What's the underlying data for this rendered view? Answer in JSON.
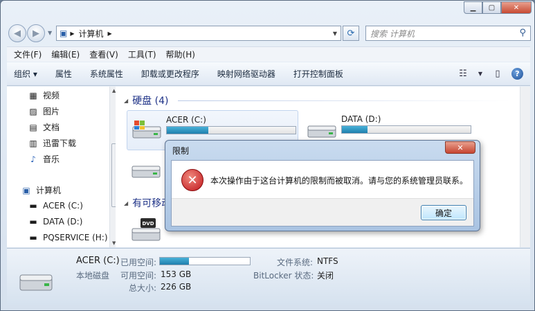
{
  "address": {
    "crumb": "计算机"
  },
  "search": {
    "placeholder": "搜索 计算机"
  },
  "menu": [
    "文件(F)",
    "编辑(E)",
    "查看(V)",
    "工具(T)",
    "帮助(H)"
  ],
  "toolbar": {
    "organize": "组织 ▾",
    "items": [
      "属性",
      "系统属性",
      "卸载或更改程序",
      "映射网络驱动器",
      "打开控制面板"
    ]
  },
  "sidebar": {
    "items": [
      {
        "label": "视频",
        "icon": "video-icon"
      },
      {
        "label": "图片",
        "icon": "picture-icon"
      },
      {
        "label": "文档",
        "icon": "document-icon"
      },
      {
        "label": "迅雷下载",
        "icon": "download-icon"
      },
      {
        "label": "音乐",
        "icon": "music-icon"
      },
      {
        "label": "计算机",
        "icon": "computer-icon"
      },
      {
        "label": "ACER (C:)",
        "icon": "drive-c-icon"
      },
      {
        "label": "DATA (D:)",
        "icon": "drive-icon"
      },
      {
        "label": "PQSERVICE (H:)",
        "icon": "drive-icon"
      }
    ]
  },
  "groups": {
    "hard_disks": "硬盘 (4)",
    "removable": "有可移动"
  },
  "drives": [
    {
      "name": "ACER (C:)",
      "used_fraction": 0.32
    },
    {
      "name": "DATA (D:)",
      "used_fraction": 0.2
    }
  ],
  "dvd": {
    "badge": "DVD"
  },
  "details": {
    "name": "ACER (C:)",
    "type": "本地磁盘",
    "used_label": "已用空间:",
    "used_fraction": 0.32,
    "free_label": "可用空间:",
    "free_value": "153 GB",
    "total_label": "总大小:",
    "total_value": "226 GB",
    "fs_label": "文件系统:",
    "fs_value": "NTFS",
    "bitlocker_label": "BitLocker 状态:",
    "bitlocker_value": "关闭"
  },
  "dialog": {
    "title": "限制",
    "message": "本次操作由于这台计算机的限制而被取消。请与您的系统管理员联系。",
    "ok": "确定"
  },
  "colors": {
    "accent": "#1e3287",
    "error": "#c0141a",
    "bar": "#1f7fae"
  }
}
